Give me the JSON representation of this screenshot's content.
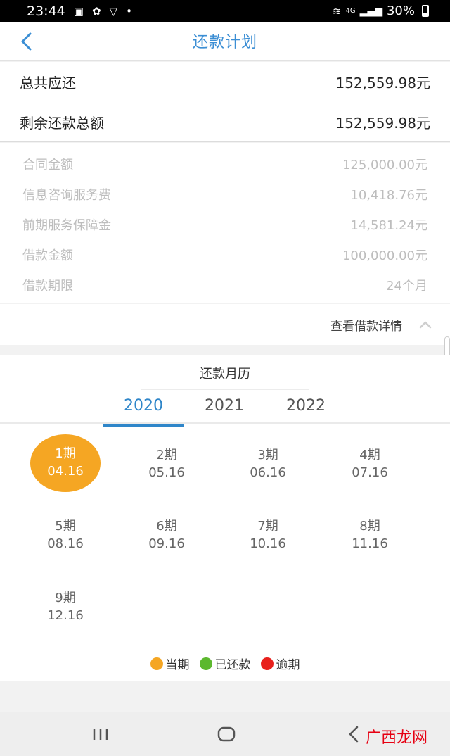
{
  "status_bar": {
    "time": "23:44",
    "battery": "30%",
    "network": "4G"
  },
  "header": {
    "title": "还款计划"
  },
  "summary": [
    {
      "label": "总共应还",
      "value": "152,559.98元"
    },
    {
      "label": "剩余还款总额",
      "value": "152,559.98元"
    }
  ],
  "details": [
    {
      "label": "合同金额",
      "value": "125,000.00元"
    },
    {
      "label": "信息咨询服务费",
      "value": "10,418.76元"
    },
    {
      "label": "前期服务保障金",
      "value": "14,581.24元"
    },
    {
      "label": "借款金额",
      "value": "100,000.00元"
    },
    {
      "label": "借款期限",
      "value": "24个月"
    }
  ],
  "toggle": {
    "label": "查看借款详情"
  },
  "calendar": {
    "title": "还款月历",
    "years": [
      "2020",
      "2021",
      "2022"
    ],
    "active_year": "2020",
    "periods": [
      {
        "period": "1期",
        "date": "04.16",
        "status": "current"
      },
      {
        "period": "2期",
        "date": "05.16",
        "status": "upcoming"
      },
      {
        "period": "3期",
        "date": "06.16",
        "status": "upcoming"
      },
      {
        "period": "4期",
        "date": "07.16",
        "status": "upcoming"
      },
      {
        "period": "5期",
        "date": "08.16",
        "status": "upcoming"
      },
      {
        "period": "6期",
        "date": "09.16",
        "status": "upcoming"
      },
      {
        "period": "7期",
        "date": "10.16",
        "status": "upcoming"
      },
      {
        "period": "8期",
        "date": "11.16",
        "status": "upcoming"
      },
      {
        "period": "9期",
        "date": "12.16",
        "status": "upcoming"
      }
    ]
  },
  "legend": [
    {
      "label": "当期",
      "color": "#f5a623"
    },
    {
      "label": "已还款",
      "color": "#5cb82e"
    },
    {
      "label": "逾期",
      "color": "#e8201c"
    }
  ],
  "watermark": "广西龙网",
  "colors": {
    "accent": "#3b8ed4",
    "current": "#f5a623"
  }
}
